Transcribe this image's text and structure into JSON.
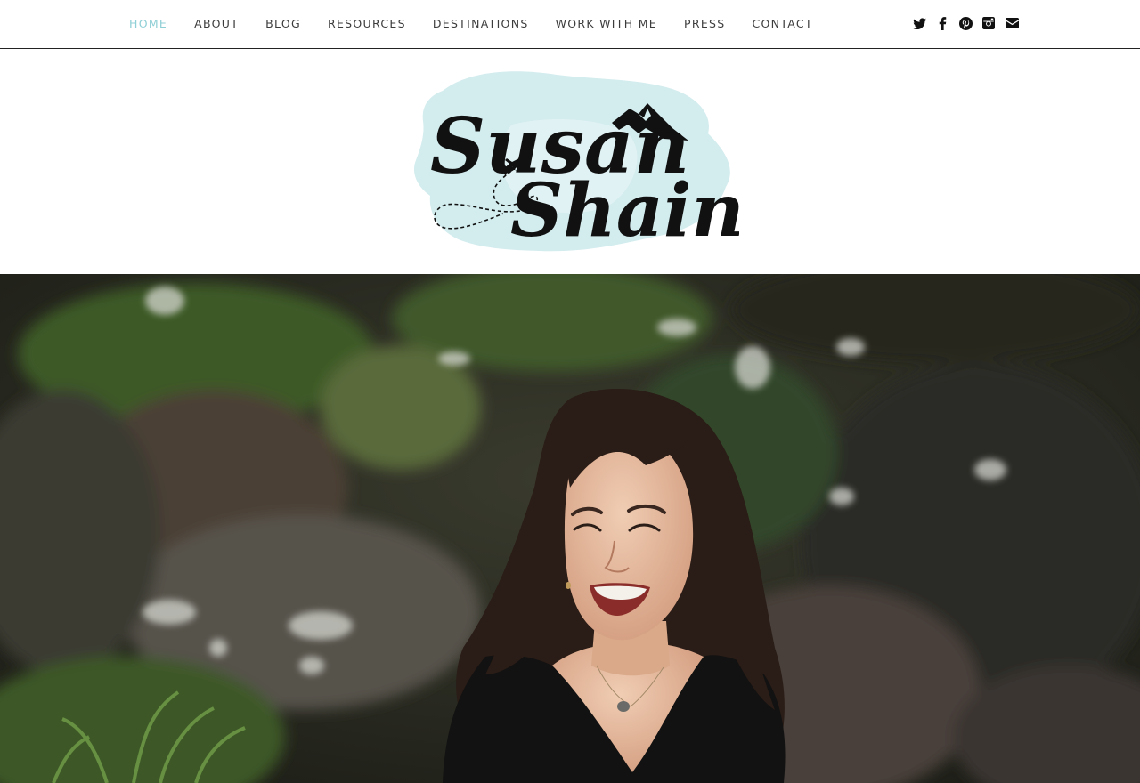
{
  "nav": {
    "items": [
      {
        "label": "HOME",
        "active": true
      },
      {
        "label": "ABOUT",
        "active": false
      },
      {
        "label": "BLOG",
        "active": false
      },
      {
        "label": "RESOURCES",
        "active": false
      },
      {
        "label": "DESTINATIONS",
        "active": false
      },
      {
        "label": "WORK WITH ME",
        "active": false
      },
      {
        "label": "PRESS",
        "active": false
      },
      {
        "label": "CONTACT",
        "active": false
      }
    ],
    "active_color": "#8fcfd6",
    "text_color": "#3c3c3c"
  },
  "social": {
    "icons": [
      "twitter-icon",
      "facebook-icon",
      "pinterest-icon",
      "instagram-icon",
      "email-icon"
    ]
  },
  "logo": {
    "line1": "Susan",
    "line2": "Shain",
    "splash_color": "#d3ecee"
  },
  "hero": {
    "subject": "smiling woman",
    "colors": {
      "background": "#2f3226",
      "foliage": "#3f5a2a",
      "hair": "#2b1e18",
      "skin": "#e6b99c",
      "shirt": "#111111"
    }
  }
}
